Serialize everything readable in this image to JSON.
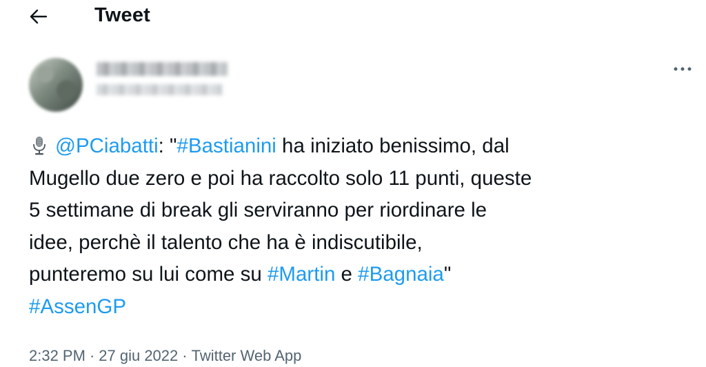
{
  "header": {
    "title": "Tweet",
    "back_icon": "arrow-left-icon"
  },
  "author": {
    "avatar": "blurred-avatar",
    "display_name": "",
    "handle": ""
  },
  "more_icon": "more-horizontal-icon",
  "colors": {
    "text": "#0f1419",
    "link": "#1d9bf0",
    "meta": "#536471"
  },
  "tweet": {
    "emoji_icon": "microphone-icon",
    "mention": "@PCiabatti",
    "after_mention": ": \"",
    "hashtag_bastianini": "#Bastianini",
    "line1_rest": " ha iniziato benissimo, dal",
    "line2": "Mugello due zero e poi ha raccolto solo 11 punti, queste",
    "line3": "5 settimane di break gli serviranno per riordinare le",
    "line4": "idee, perchè il talento che ha è indiscutibile,",
    "line5_start": "punteremo su lui come su ",
    "hashtag_martin": "#Martin",
    "line5_mid": " e ",
    "hashtag_bagnaia": "#Bagnaia",
    "line5_end": "\"",
    "hashtag_assengp": "#AssenGP"
  },
  "meta": {
    "time": "2:32 PM",
    "separator": "·",
    "date": "27 giu 2022",
    "app": "Twitter Web App"
  }
}
